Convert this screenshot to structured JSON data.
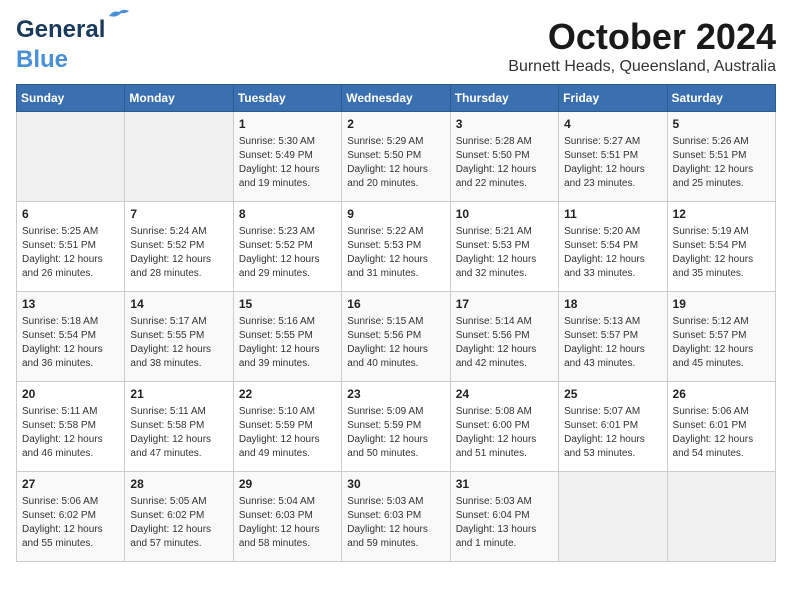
{
  "logo": {
    "line1": "General",
    "line2": "Blue"
  },
  "title": "October 2024",
  "location": "Burnett Heads, Queensland, Australia",
  "days_header": [
    "Sunday",
    "Monday",
    "Tuesday",
    "Wednesday",
    "Thursday",
    "Friday",
    "Saturday"
  ],
  "weeks": [
    [
      {
        "day": "",
        "empty": true
      },
      {
        "day": "",
        "empty": true
      },
      {
        "day": "1",
        "sunrise": "5:30 AM",
        "sunset": "5:49 PM",
        "daylight": "12 hours and 19 minutes."
      },
      {
        "day": "2",
        "sunrise": "5:29 AM",
        "sunset": "5:50 PM",
        "daylight": "12 hours and 20 minutes."
      },
      {
        "day": "3",
        "sunrise": "5:28 AM",
        "sunset": "5:50 PM",
        "daylight": "12 hours and 22 minutes."
      },
      {
        "day": "4",
        "sunrise": "5:27 AM",
        "sunset": "5:51 PM",
        "daylight": "12 hours and 23 minutes."
      },
      {
        "day": "5",
        "sunrise": "5:26 AM",
        "sunset": "5:51 PM",
        "daylight": "12 hours and 25 minutes."
      }
    ],
    [
      {
        "day": "6",
        "sunrise": "5:25 AM",
        "sunset": "5:51 PM",
        "daylight": "12 hours and 26 minutes."
      },
      {
        "day": "7",
        "sunrise": "5:24 AM",
        "sunset": "5:52 PM",
        "daylight": "12 hours and 28 minutes."
      },
      {
        "day": "8",
        "sunrise": "5:23 AM",
        "sunset": "5:52 PM",
        "daylight": "12 hours and 29 minutes."
      },
      {
        "day": "9",
        "sunrise": "5:22 AM",
        "sunset": "5:53 PM",
        "daylight": "12 hours and 31 minutes."
      },
      {
        "day": "10",
        "sunrise": "5:21 AM",
        "sunset": "5:53 PM",
        "daylight": "12 hours and 32 minutes."
      },
      {
        "day": "11",
        "sunrise": "5:20 AM",
        "sunset": "5:54 PM",
        "daylight": "12 hours and 33 minutes."
      },
      {
        "day": "12",
        "sunrise": "5:19 AM",
        "sunset": "5:54 PM",
        "daylight": "12 hours and 35 minutes."
      }
    ],
    [
      {
        "day": "13",
        "sunrise": "5:18 AM",
        "sunset": "5:54 PM",
        "daylight": "12 hours and 36 minutes."
      },
      {
        "day": "14",
        "sunrise": "5:17 AM",
        "sunset": "5:55 PM",
        "daylight": "12 hours and 38 minutes."
      },
      {
        "day": "15",
        "sunrise": "5:16 AM",
        "sunset": "5:55 PM",
        "daylight": "12 hours and 39 minutes."
      },
      {
        "day": "16",
        "sunrise": "5:15 AM",
        "sunset": "5:56 PM",
        "daylight": "12 hours and 40 minutes."
      },
      {
        "day": "17",
        "sunrise": "5:14 AM",
        "sunset": "5:56 PM",
        "daylight": "12 hours and 42 minutes."
      },
      {
        "day": "18",
        "sunrise": "5:13 AM",
        "sunset": "5:57 PM",
        "daylight": "12 hours and 43 minutes."
      },
      {
        "day": "19",
        "sunrise": "5:12 AM",
        "sunset": "5:57 PM",
        "daylight": "12 hours and 45 minutes."
      }
    ],
    [
      {
        "day": "20",
        "sunrise": "5:11 AM",
        "sunset": "5:58 PM",
        "daylight": "12 hours and 46 minutes."
      },
      {
        "day": "21",
        "sunrise": "5:11 AM",
        "sunset": "5:58 PM",
        "daylight": "12 hours and 47 minutes."
      },
      {
        "day": "22",
        "sunrise": "5:10 AM",
        "sunset": "5:59 PM",
        "daylight": "12 hours and 49 minutes."
      },
      {
        "day": "23",
        "sunrise": "5:09 AM",
        "sunset": "5:59 PM",
        "daylight": "12 hours and 50 minutes."
      },
      {
        "day": "24",
        "sunrise": "5:08 AM",
        "sunset": "6:00 PM",
        "daylight": "12 hours and 51 minutes."
      },
      {
        "day": "25",
        "sunrise": "5:07 AM",
        "sunset": "6:01 PM",
        "daylight": "12 hours and 53 minutes."
      },
      {
        "day": "26",
        "sunrise": "5:06 AM",
        "sunset": "6:01 PM",
        "daylight": "12 hours and 54 minutes."
      }
    ],
    [
      {
        "day": "27",
        "sunrise": "5:06 AM",
        "sunset": "6:02 PM",
        "daylight": "12 hours and 55 minutes."
      },
      {
        "day": "28",
        "sunrise": "5:05 AM",
        "sunset": "6:02 PM",
        "daylight": "12 hours and 57 minutes."
      },
      {
        "day": "29",
        "sunrise": "5:04 AM",
        "sunset": "6:03 PM",
        "daylight": "12 hours and 58 minutes."
      },
      {
        "day": "30",
        "sunrise": "5:03 AM",
        "sunset": "6:03 PM",
        "daylight": "12 hours and 59 minutes."
      },
      {
        "day": "31",
        "sunrise": "5:03 AM",
        "sunset": "6:04 PM",
        "daylight": "13 hours and 1 minute."
      },
      {
        "day": "",
        "empty": true
      },
      {
        "day": "",
        "empty": true
      }
    ]
  ],
  "labels": {
    "sunrise": "Sunrise:",
    "sunset": "Sunset:",
    "daylight": "Daylight:"
  }
}
